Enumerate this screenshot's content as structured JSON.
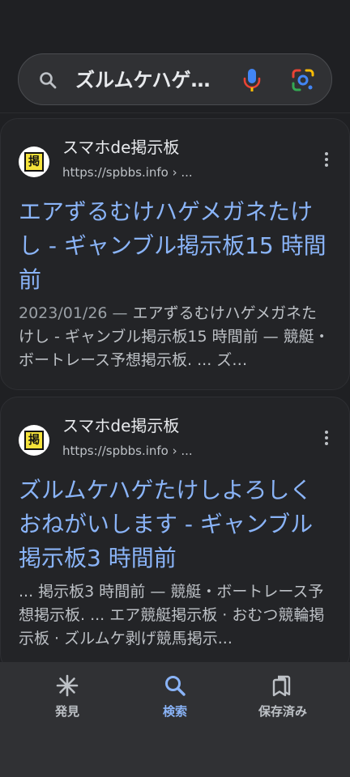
{
  "search": {
    "query": "ズルムケハゲ…",
    "icons": {
      "search": "search-icon",
      "mic": "mic-icon",
      "lens": "lens-icon"
    }
  },
  "results": [
    {
      "site_name": "スマホde掲示板",
      "url": "https://spbbs.info › ...",
      "favicon_text": "掲",
      "title": "エアずるむけハゲメガネたけし - ギャンブル掲示板15 時間前",
      "date": "2023/01/26 — ",
      "snippet": "エアずるむけハゲメガネたけし - ギャンブル掲示板15 時間前 — 競艇・ボートレース予想掲示板. ... ズ…"
    },
    {
      "site_name": "スマホde掲示板",
      "url": "https://spbbs.info › ...",
      "favicon_text": "掲",
      "title": "ズルムケハゲたけしよろしくおねがいします - ギャンブル掲示板3 時間前",
      "date": "",
      "snippet": "... 掲示板3 時間前 — 競艇・ボートレース予想掲示板. ... エア競艇掲示板 · おむつ競輪掲示板 · ズルムケ剥げ競馬掲示..."
    }
  ],
  "bottom_nav": {
    "discover": "発見",
    "search": "検索",
    "saved": "保存済み",
    "active": "search"
  },
  "colors": {
    "background": "#1f2023",
    "link_blue": "#8ab4f8",
    "snippet_gray": "#bdc1c6"
  }
}
